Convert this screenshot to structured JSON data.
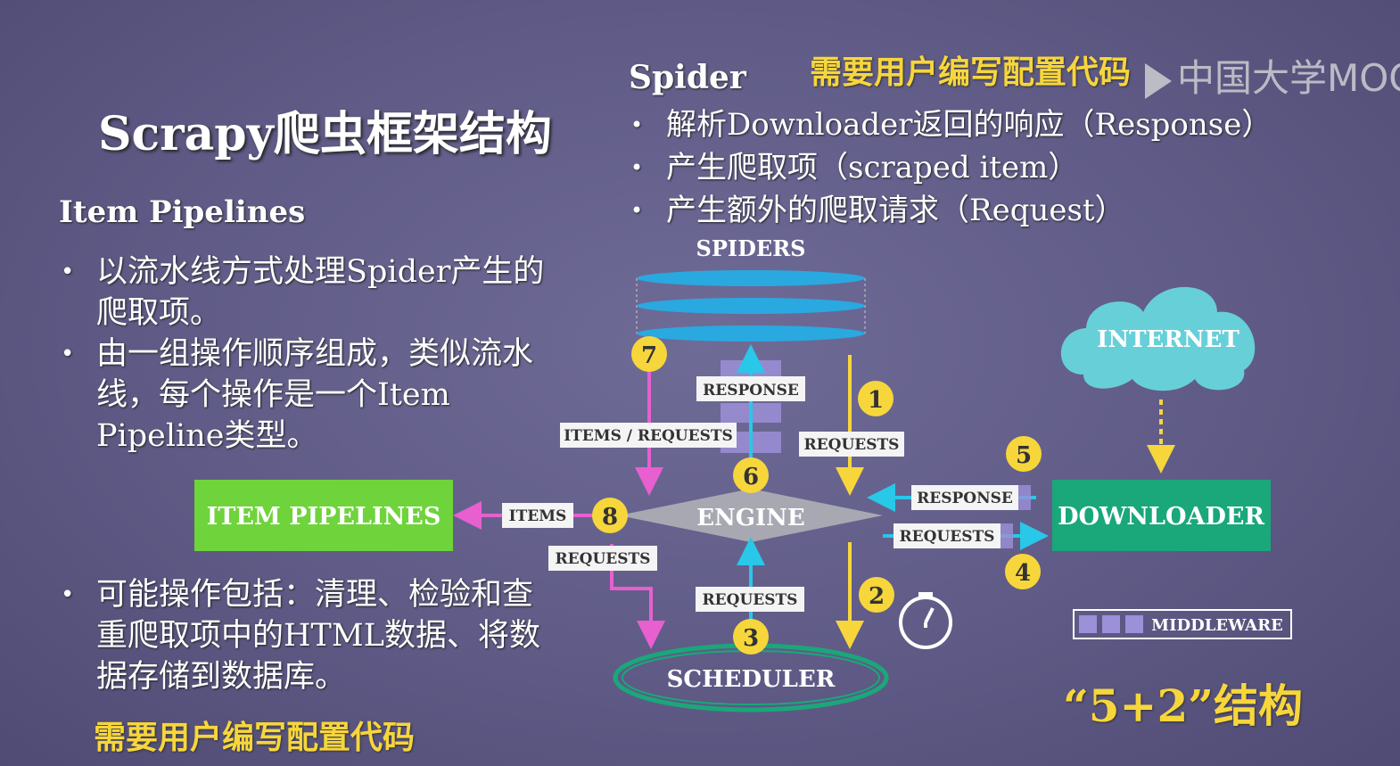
{
  "title": "Scrapy爬虫框架结构",
  "left": {
    "heading": "Item Pipelines",
    "bullets1": [
      "以流水线方式处理Spider产生的爬取项。",
      "由一组操作顺序组成，类似流水线，每个操作是一个Item Pipeline类型。"
    ],
    "bullets2": [
      "可能操作包括：清理、检验和查重爬取项中的HTML数据、将数据存储到数据库。"
    ],
    "note": "需要用户编写配置代码"
  },
  "right": {
    "heading": "Spider",
    "note": "需要用户编写配置代码",
    "bullets": [
      "解析Downloader返回的响应（Response）",
      "产生爬取项（scraped item）",
      "产生额外的爬取请求（Request）"
    ]
  },
  "watermark": "中国大学MOOC",
  "diagram": {
    "spiders": "SPIDERS",
    "internet": "INTERNET",
    "engine": "ENGINE",
    "scheduler": "SCHEDULER",
    "downloader": "DOWNLOADER",
    "item_pipelines": "ITEM PIPELINES",
    "middleware": "MIDDLEWARE",
    "labels": {
      "response_top": "RESPONSE",
      "items_requests": "ITEMS / REQUESTS",
      "requests_1": "REQUESTS",
      "response_right": "RESPONSE",
      "requests_right": "REQUESTS",
      "items": "ITEMS",
      "requests_left": "REQUESTS",
      "requests_bottom": "REQUESTS"
    },
    "steps": [
      "1",
      "2",
      "3",
      "4",
      "5",
      "6",
      "7",
      "8"
    ],
    "structure": "“5+2”结构"
  },
  "colors": {
    "yellow": "#f7d63c",
    "green_downloader": "#1aa77a",
    "green_pipelines": "#6fd33c",
    "cyan": "#29c7e8",
    "pink": "#e85fd0",
    "spider_blue": "#2aa8e0"
  }
}
